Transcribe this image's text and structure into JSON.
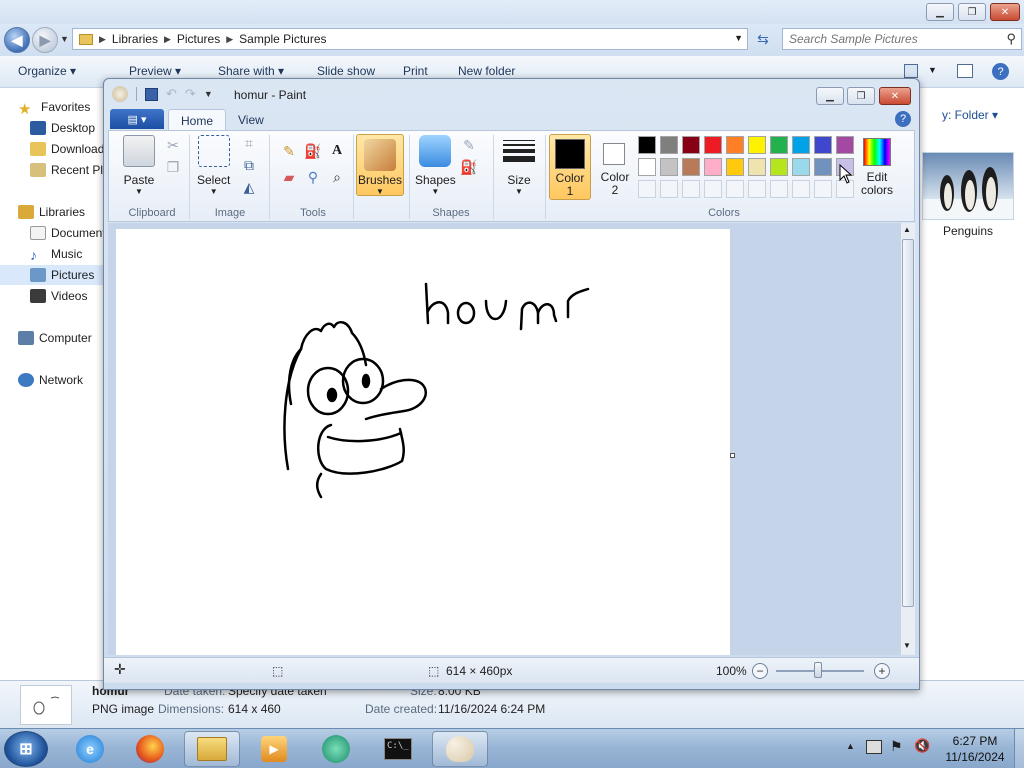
{
  "explorer": {
    "address": [
      "Libraries",
      "Pictures",
      "Sample Pictures"
    ],
    "search_placeholder": "Search Sample Pictures",
    "toolbar": {
      "organize": "Organize ▾",
      "preview": "Preview ▾",
      "share_with": "Share with ▾",
      "slide_show": "Slide show",
      "print": "Print",
      "new_folder": "New folder"
    },
    "sidebar": {
      "favorites": "Favorites",
      "desktop": "Desktop",
      "downloads": "Downloads",
      "recent_places": "Recent Places",
      "libraries": "Libraries",
      "documents": "Documents",
      "music": "Music",
      "pictures": "Pictures",
      "videos": "Videos",
      "computer": "Computer",
      "network": "Network"
    },
    "arrange_by": "y: Folder ▾",
    "thumbnail_label": "Penguins",
    "details": {
      "name": "homur",
      "type": "PNG image",
      "date_taken_label": "Date taken:",
      "date_taken_value": "Specify date taken",
      "dimensions_label": "Dimensions:",
      "dimensions_value": "614 x 460",
      "size_label": "Size:",
      "size_value": "8.00 KB",
      "date_created_label": "Date created:",
      "date_created_value": "11/16/2024 6:24 PM"
    }
  },
  "paint": {
    "title": "homur - Paint",
    "tabs": {
      "home": "Home",
      "view": "View"
    },
    "ribbon": {
      "paste": "Paste",
      "clipboard": "Clipboard",
      "select": "Select",
      "image": "Image",
      "tools": "Tools",
      "brushes": "Brushes",
      "shapes_btn": "Shapes",
      "shapes_grp": "Shapes",
      "size": "Size",
      "color1": "Color\n1",
      "color1_a": "Color",
      "color1_b": "1",
      "color2_a": "Color",
      "color2_b": "2",
      "colors": "Colors",
      "edit_colors_a": "Edit",
      "edit_colors_b": "colors"
    },
    "palette_row1": [
      "#000000",
      "#7f7f7f",
      "#880015",
      "#ed1c24",
      "#ff7f27",
      "#fff200",
      "#22b14c",
      "#00a2e8",
      "#3f48cc",
      "#a349a4"
    ],
    "palette_row2": [
      "#ffffff",
      "#c3c3c3",
      "#b97a57",
      "#ffaec9",
      "#ffc90e",
      "#efe4b0",
      "#b5e61d",
      "#99d9ea",
      "#7092be",
      "#c8bfe7"
    ],
    "color1_value": "#000000",
    "color2_value": "#ffffff",
    "canvas_text": "houmr",
    "status": {
      "dimensions": "614 × 460px",
      "zoom": "100%"
    }
  },
  "taskbar": {
    "time": "6:27 PM",
    "date": "11/16/2024"
  }
}
